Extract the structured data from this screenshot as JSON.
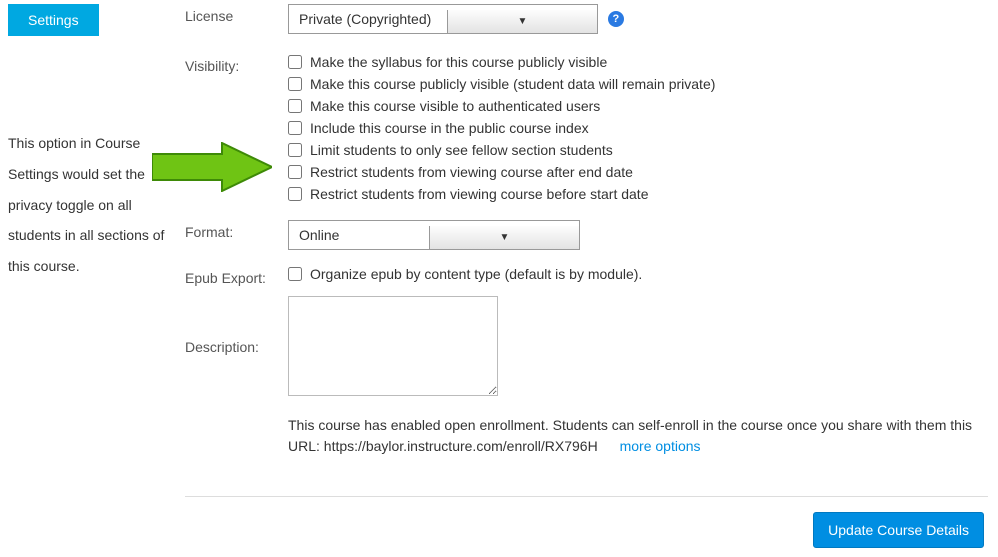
{
  "settings_button": "Settings",
  "annotation_text": "This option in Course Settings would set the privacy toggle on all students in all sections of this course.",
  "license": {
    "label": "License",
    "selected": "Private (Copyrighted)"
  },
  "visibility": {
    "label": "Visibility:",
    "options": [
      "Make the syllabus for this course publicly visible",
      "Make this course publicly visible (student data will remain private)",
      "Make this course visible to authenticated users",
      "Include this course in the public course index",
      "Limit students to only see fellow section students",
      "Restrict students from viewing course after end date",
      "Restrict students from viewing course before start date"
    ]
  },
  "format": {
    "label": "Format:",
    "selected": "Online"
  },
  "epub": {
    "label": "Epub Export:",
    "option": "Organize epub by content type (default is by module)."
  },
  "description": {
    "label": "Description:",
    "value": ""
  },
  "enrollment": {
    "text_part1": "This course has enabled open enrollment. Students can self-enroll in the course once you share with them this URL: ",
    "url": "https://baylor.instructure.com/enroll/RX796H",
    "more_options": "more options"
  },
  "update_button": "Update Course Details",
  "help_icon_char": "?"
}
